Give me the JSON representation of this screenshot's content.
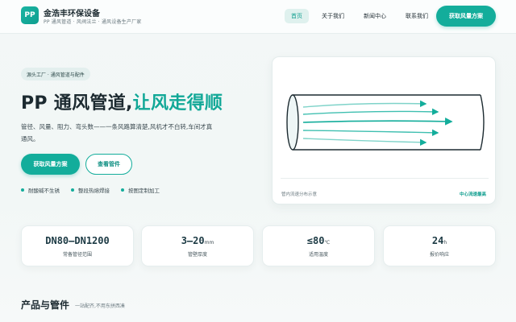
{
  "header": {
    "logo_text": "PP",
    "brand_name": "金浩丰环保设备",
    "tagline": "PP 通风管道 · 风阀法兰 · 通风设备生产厂家",
    "nav": [
      {
        "label": "首页",
        "active": true
      },
      {
        "label": "关于我们",
        "active": false
      },
      {
        "label": "新闻中心",
        "active": false
      },
      {
        "label": "联系我们",
        "active": false
      }
    ],
    "cta_label": "获取风量方案"
  },
  "hero": {
    "crumb": "源头工厂 · 通风管道与配件",
    "title_main": "PP 通风管道,",
    "title_accent": "让风走得顺",
    "description": "管径、风量、阻力、弯头数——一条风路算清楚,风机才不白转,车间才真通风。",
    "primary_button": "获取风量方案",
    "secondary_button": "查看管件",
    "features": [
      "耐酸碱不生锈",
      "整段热熔焊接",
      "按图定制加工"
    ]
  },
  "pipe_card": {
    "caption": "管内流速分布示意",
    "tag": "中心流速最高"
  },
  "stats": [
    {
      "value": "DN80–DN1200",
      "unit": "",
      "label": "常备管径范围"
    },
    {
      "value": "3–20",
      "unit": "mm",
      "label": "管壁厚度"
    },
    {
      "value": "≤80",
      "unit": "℃",
      "label": "适用温度"
    },
    {
      "value": "24",
      "unit": "h",
      "label": "报价响应"
    }
  ],
  "products": {
    "title": "产品与管件",
    "subtitle": "一站配齐,不用东拼西凑"
  },
  "colors": {
    "accent": "#13ad9b",
    "text_dark": "#1c2a30"
  }
}
